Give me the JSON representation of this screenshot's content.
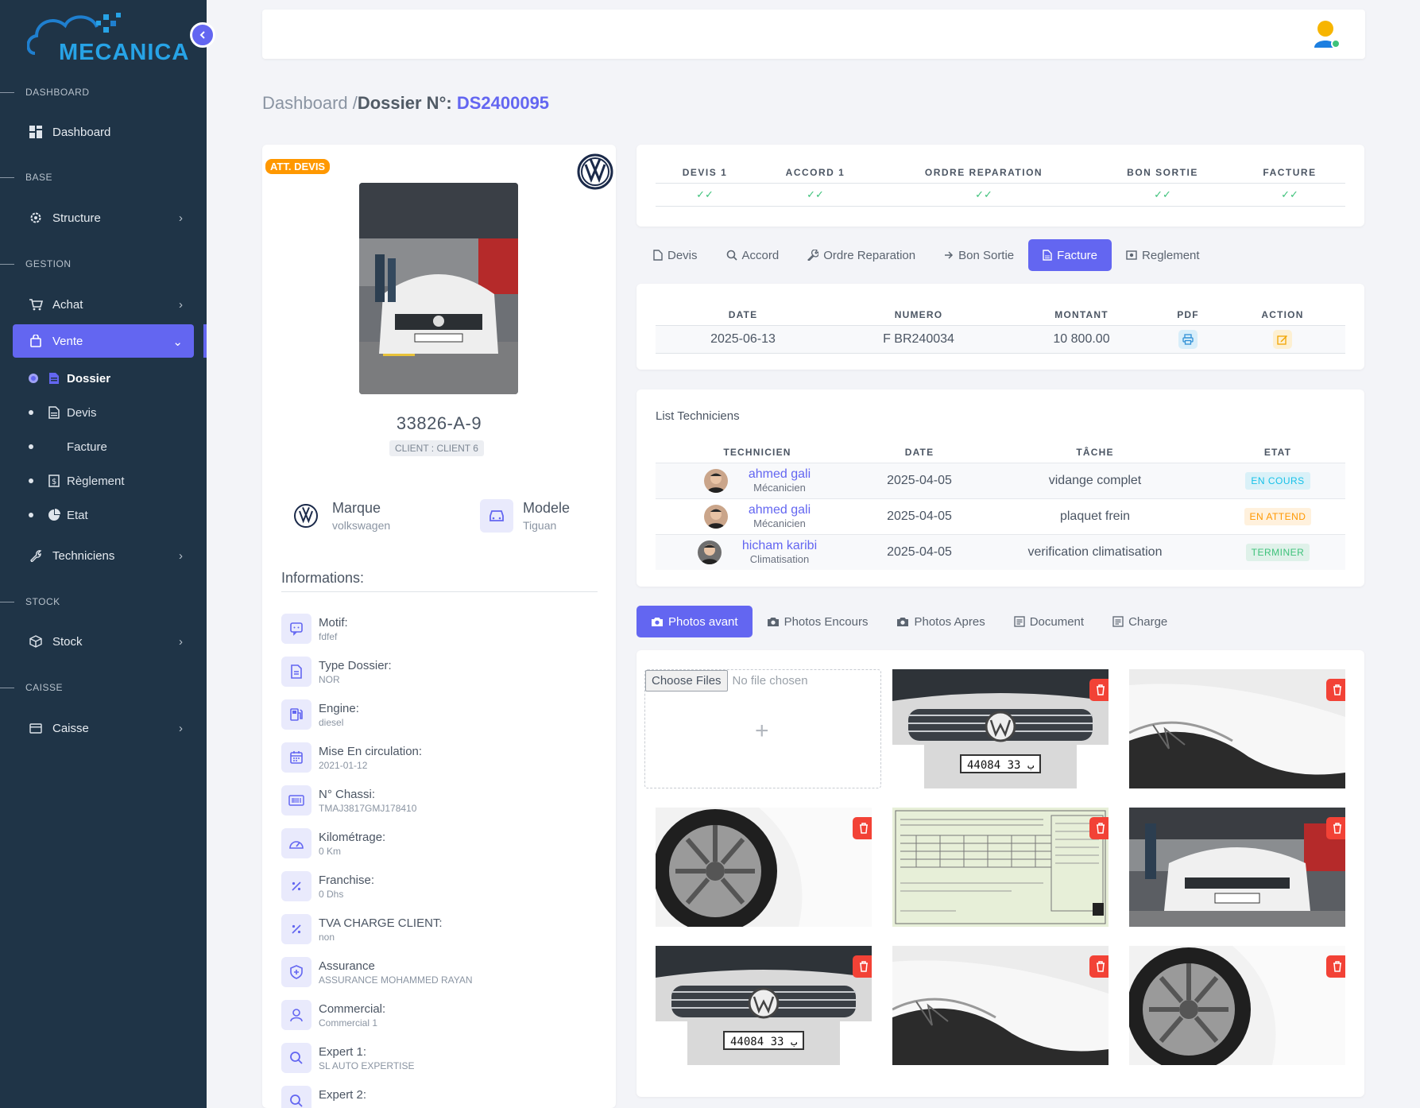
{
  "brand": {
    "name": "MECANICA",
    "icon": "cloud-pixel-logo",
    "accent": "#6366f1"
  },
  "sidebar": {
    "sections": [
      "DASHBOARD",
      "BASE",
      "GESTION",
      "STOCK",
      "CAISSE"
    ],
    "items": [
      {
        "label": "Dashboard",
        "icon": "grid-icon"
      },
      {
        "label": "Structure",
        "icon": "gear-icon"
      },
      {
        "label": "Achat",
        "icon": "cart-icon"
      },
      {
        "label": "Vente",
        "icon": "bag-icon"
      },
      {
        "label": "Techniciens",
        "icon": "wrench-icon"
      },
      {
        "label": "Stock",
        "icon": "cube-icon"
      },
      {
        "label": "Caisse",
        "icon": "register-icon"
      }
    ],
    "sub": [
      {
        "label": "Dossier"
      },
      {
        "label": "Devis"
      },
      {
        "label": "Facture"
      },
      {
        "label": "Règlement"
      },
      {
        "label": "Etat"
      }
    ]
  },
  "breadcrumb": {
    "root": "Dashboard /",
    "title": "Dossier N°:",
    "number": "DS2400095"
  },
  "vehicle": {
    "status": "ATT. DEVIS",
    "plate": "33826-A-9",
    "client": "CLIENT : CLIENT 6",
    "marque_label": "Marque",
    "marque": "volkswagen",
    "modele_label": "Modele",
    "modele": "Tiguan"
  },
  "info": {
    "title": "Informations:",
    "rows": [
      {
        "k": "Motif:",
        "v": "fdfef",
        "icon": "chat-icon"
      },
      {
        "k": "Type Dossier:",
        "v": "NOR",
        "icon": "document-icon"
      },
      {
        "k": "Engine:",
        "v": "diesel",
        "icon": "fuel-icon"
      },
      {
        "k": "Mise En circulation:",
        "v": "2021-01-12",
        "icon": "calendar-icon"
      },
      {
        "k": "N° Chassi:",
        "v": "TMAJ3817GMJ178410",
        "icon": "barcode-icon"
      },
      {
        "k": "Kilométrage:",
        "v": "0 Km",
        "icon": "speedometer-icon"
      },
      {
        "k": "Franchise:",
        "v": "0 Dhs",
        "icon": "percent-icon"
      },
      {
        "k": "TVA CHARGE CLIENT:",
        "v": "non",
        "icon": "percent-icon"
      },
      {
        "k": "Assurance",
        "v": "ASSURANCE MOHAMMED RAYAN",
        "icon": "shield-icon"
      },
      {
        "k": "Commercial:",
        "v": "Commercial 1",
        "icon": "user-icon"
      },
      {
        "k": "Expert 1:",
        "v": "SL AUTO EXPERTISE",
        "icon": "search-icon"
      },
      {
        "k": "Expert 2:",
        "v": "---",
        "icon": "search-icon"
      }
    ]
  },
  "steps": [
    "DEVIS 1",
    "ACCORD 1",
    "ORDRE REPARATION",
    "BON SORTIE",
    "FACTURE"
  ],
  "doc_tabs": [
    "Devis",
    "Accord",
    "Ordre Reparation",
    "Bon Sortie",
    "Facture",
    "Reglement"
  ],
  "facture_table": {
    "headers": [
      "DATE",
      "NUMERO",
      "MONTANT",
      "PDF",
      "ACTION"
    ],
    "row": {
      "date": "2025-06-13",
      "numero": "F BR240034",
      "montant": "10 800.00"
    }
  },
  "techniciens": {
    "title": "List Techniciens",
    "headers": [
      "TECHNICIEN",
      "DATE",
      "TÂCHE",
      "ETAT"
    ],
    "rows": [
      {
        "name": "ahmed gali",
        "role": "Mécanicien",
        "date": "2025-04-05",
        "tache": "vidange complet",
        "etat": "EN COURS",
        "etat_color": "#17c1e8"
      },
      {
        "name": "ahmed gali",
        "role": "Mécanicien",
        "date": "2025-04-05",
        "tache": "plaquet frein",
        "etat": "EN ATTEND",
        "etat_color": "#ff9800"
      },
      {
        "name": "hicham karibi",
        "role": "Climatisation",
        "date": "2025-04-05",
        "tache": "verification climatisation",
        "etat": "TERMINER",
        "etat_color": "#3ec27b"
      }
    ]
  },
  "photo_tabs": [
    "Photos avant",
    "Photos Encours",
    "Photos Apres",
    "Document",
    "Charge"
  ],
  "upload": {
    "button": "Choose Files",
    "status": "No file chosen",
    "plus": "+"
  }
}
